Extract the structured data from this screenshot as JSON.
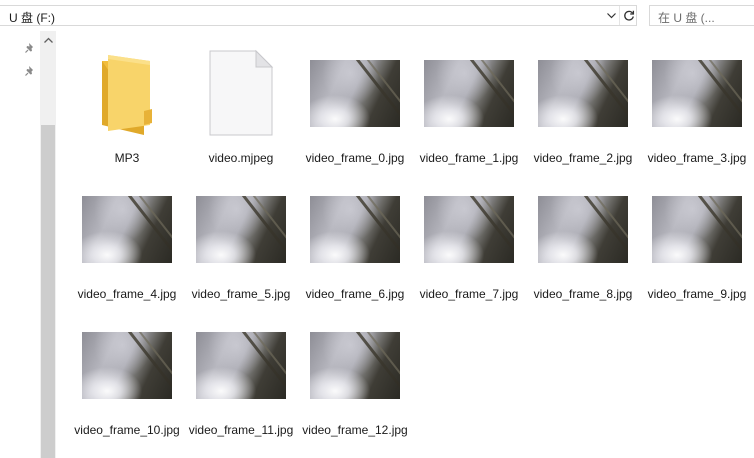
{
  "address": {
    "path": "U 盘 (F:)",
    "dropdown_icon": "chevron-down-icon",
    "refresh_icon": "refresh-icon"
  },
  "search": {
    "placeholder": "在 U 盘 (..."
  },
  "nav_pane": {
    "pin_icons": [
      "pin-icon",
      "pin-icon"
    ]
  },
  "files": [
    {
      "name": "MP3",
      "type": "folder"
    },
    {
      "name": "video.mjpeg",
      "type": "document"
    },
    {
      "name": "video_frame_0.jpg",
      "type": "image"
    },
    {
      "name": "video_frame_1.jpg",
      "type": "image"
    },
    {
      "name": "video_frame_2.jpg",
      "type": "image"
    },
    {
      "name": "video_frame_3.jpg",
      "type": "image"
    },
    {
      "name": "video_frame_4.jpg",
      "type": "image"
    },
    {
      "name": "video_frame_5.jpg",
      "type": "image"
    },
    {
      "name": "video_frame_6.jpg",
      "type": "image"
    },
    {
      "name": "video_frame_7.jpg",
      "type": "image"
    },
    {
      "name": "video_frame_8.jpg",
      "type": "image"
    },
    {
      "name": "video_frame_9.jpg",
      "type": "image"
    },
    {
      "name": "video_frame_10.jpg",
      "type": "image"
    },
    {
      "name": "video_frame_11.jpg",
      "type": "image"
    },
    {
      "name": "video_frame_12.jpg",
      "type": "image"
    }
  ],
  "colors": {
    "folder": "#f5c342",
    "folder_dark": "#e0a92a",
    "border": "#d9d9d9",
    "scrollbar_track": "#f0f0f0",
    "scrollbar_thumb": "#cdcdcd"
  }
}
